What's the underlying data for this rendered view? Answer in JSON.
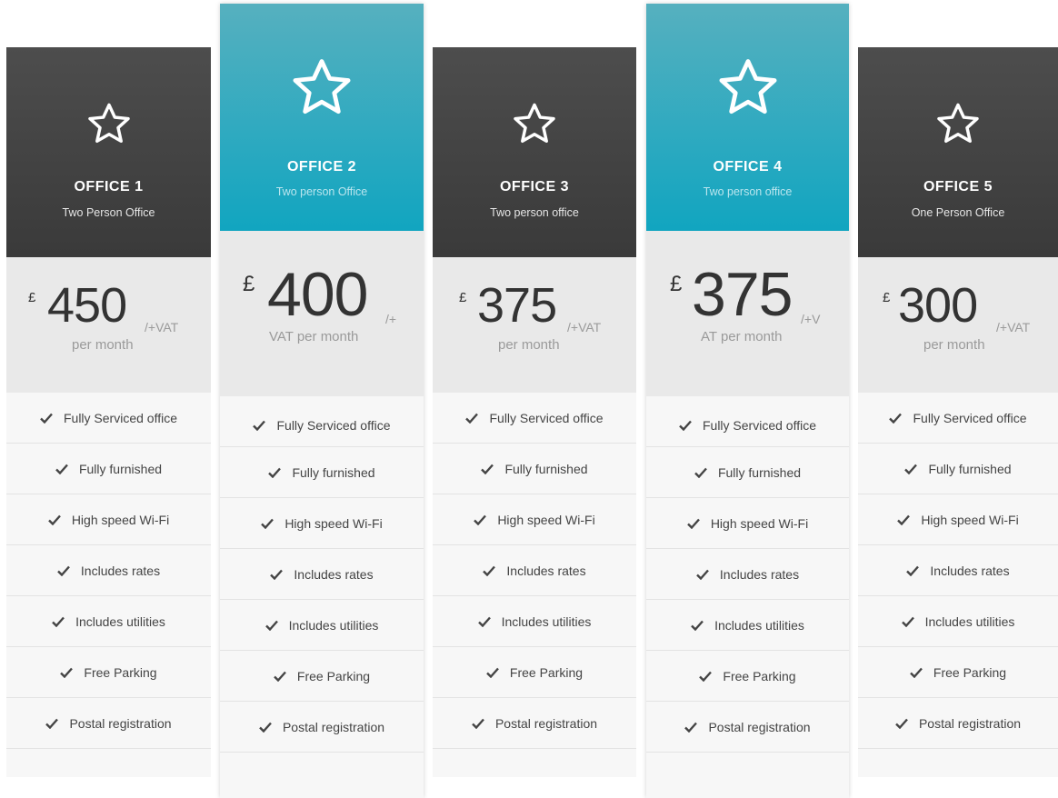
{
  "icons": {
    "plan_icon": "star-outline-icon",
    "feature_icon": "check-icon"
  },
  "colors": {
    "standard_header": "#3f3f3f",
    "featured_header": "#15a7c1",
    "price_band": "#e9e9e9",
    "features_bg": "#f7f7f7"
  },
  "plans": [
    {
      "name": "OFFICE 1",
      "subtitle": "Two Person Office",
      "currency": "£",
      "amount": "450",
      "vat": "/+VAT",
      "period": "per month",
      "featured": false
    },
    {
      "name": "OFFICE 2",
      "subtitle": "Two person Office",
      "currency": "£",
      "amount": "400",
      "vat": "/+",
      "period": "VAT per month",
      "featured": true
    },
    {
      "name": "OFFICE 3",
      "subtitle": "Two person office",
      "currency": "£",
      "amount": "375",
      "vat": "/+VAT",
      "period": "per month",
      "featured": false
    },
    {
      "name": "OFFICE 4",
      "subtitle": "Two person office",
      "currency": "£",
      "amount": "375",
      "vat": "/+V",
      "period": "AT per month",
      "featured": true
    },
    {
      "name": "OFFICE 5",
      "subtitle": "One Person Office",
      "currency": "£",
      "amount": "300",
      "vat": "/+VAT",
      "period": "per month",
      "featured": false
    }
  ],
  "features": [
    "Fully Serviced office",
    "Fully furnished",
    "High speed Wi-Fi",
    "Includes rates",
    "Includes utilities",
    "Free Parking",
    "Postal registration"
  ]
}
